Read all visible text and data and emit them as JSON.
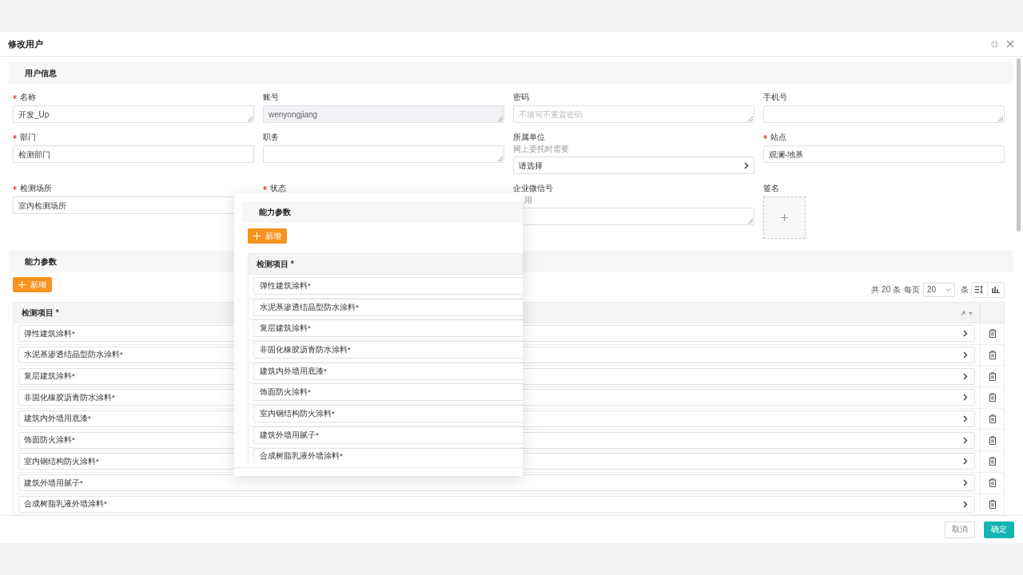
{
  "dialog": {
    "title": "修改用户"
  },
  "user_info": {
    "title": "用户信息",
    "fields": [
      {
        "label": "名称",
        "required": true,
        "kind": "textarea",
        "value": "开发_Up"
      },
      {
        "label": "账号",
        "required": false,
        "kind": "textarea",
        "value": "wenyongjiang",
        "disabled": true
      },
      {
        "label": "密码",
        "required": false,
        "kind": "textarea",
        "placeholder": "不填写不重置密码"
      },
      {
        "label": "手机号",
        "required": false,
        "kind": "textarea"
      },
      {
        "label": "部门",
        "required": true,
        "kind": "input",
        "value": "检测部门"
      },
      {
        "label": "职务",
        "required": false,
        "kind": "textarea"
      },
      {
        "label": "所属单位",
        "required": false,
        "kind": "select",
        "hint": "网上委托时需要",
        "value": "请选择"
      },
      {
        "label": "站点",
        "required": true,
        "kind": "input",
        "value": "观澜-地基"
      },
      {
        "label": "检测场所",
        "required": true,
        "kind": "input",
        "value": "室内检测场所"
      },
      {
        "label": "状态",
        "required": true,
        "kind": "none"
      },
      {
        "label": "企业微信号",
        "required": false,
        "kind": "textarea",
        "hint": "用"
      },
      {
        "label": "签名",
        "required": false,
        "kind": "upload"
      }
    ]
  },
  "capability": {
    "title": "能力参数",
    "add_button": "新增",
    "pagination": {
      "total": "共 20 条",
      "per_page_label": "每页",
      "page_size": "20",
      "unit": "条"
    },
    "table": {
      "column": "检测项目 *",
      "rows": [
        {
          "item": "弹性建筑涂料*"
        },
        {
          "item": "水泥基渗透结晶型防水涂料*"
        },
        {
          "item": "复层建筑涂料*"
        },
        {
          "item": "非固化橡胶沥青防水涂料*"
        },
        {
          "item": "建筑内外墙用底漆*"
        },
        {
          "item": "饰面防火涂料*"
        },
        {
          "item": "室内钢结构防火涂料*"
        },
        {
          "item": "建筑外墙用腻子*"
        },
        {
          "item": "合成树脂乳液外墙涂料*"
        }
      ]
    }
  },
  "drag_preview": {
    "title": "能力参数",
    "add_button": "新增",
    "column": "检测项目 *",
    "rows": [
      {
        "item": "弹性建筑涂料*"
      },
      {
        "item": "水泥基渗透结晶型防水涂料*"
      },
      {
        "item": "复层建筑涂料*"
      },
      {
        "item": "非固化橡胶沥青防水涂料*"
      },
      {
        "item": "建筑内外墙用底漆*"
      },
      {
        "item": "饰面防火涂料*"
      },
      {
        "item": "室内钢结构防火涂料*"
      },
      {
        "item": "建筑外墙用腻子*"
      },
      {
        "item": "合成树脂乳液外墙涂料*"
      }
    ]
  },
  "footer": {
    "buttons": [
      {
        "label": "取消",
        "kind": "default"
      },
      {
        "label": "确定",
        "kind": "primary"
      }
    ]
  }
}
